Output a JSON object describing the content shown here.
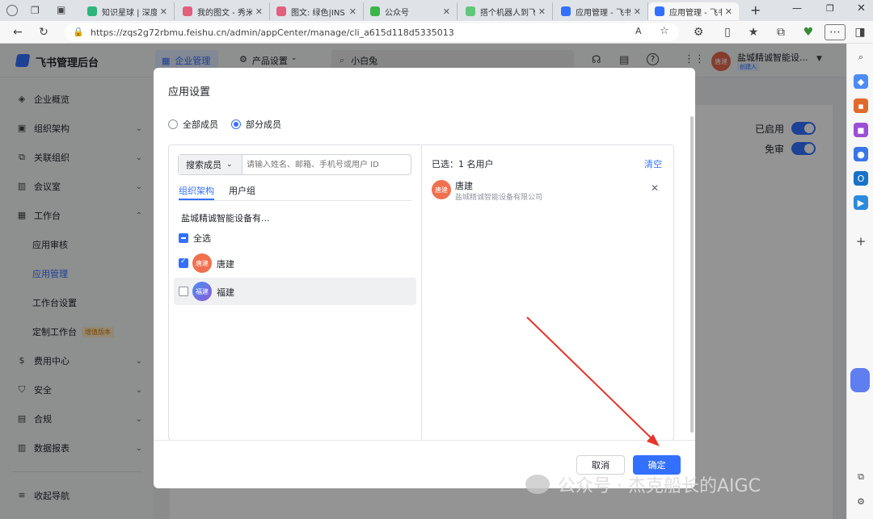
{
  "browser": {
    "tabs": [
      {
        "label": "知识星球 | 深度连",
        "color": "#2fb57b"
      },
      {
        "label": "我的图文 - 秀米XI",
        "color": "#e0607e"
      },
      {
        "label": "图文: 绿色|INS|简",
        "color": "#e0607e"
      },
      {
        "label": "公众号",
        "color": "#3bb54a"
      },
      {
        "label": "搭个机器人到飞书",
        "color": "#5ec77a"
      },
      {
        "label": "应用管理 - 飞书管",
        "color": "#3370ff"
      },
      {
        "label": "应用管理 - 飞书管",
        "color": "#3370ff"
      }
    ],
    "url": "https://zqs2g72rbmu.feishu.cn/admin/appCenter/manage/cli_a615d118d5335013"
  },
  "app": {
    "logo": "飞书管理后台",
    "nav_tabs": [
      "企业管理",
      "产品设置"
    ],
    "search_value": "小白兔",
    "org_name": "盐城精诚智能设...",
    "org_badge": "创建人",
    "avatar_text": "唐建"
  },
  "sidebar": {
    "items": [
      {
        "label": "企业概览",
        "icon": "layers-icon"
      },
      {
        "label": "组织架构",
        "icon": "org-icon"
      },
      {
        "label": "关联组织",
        "icon": "link-icon"
      },
      {
        "label": "会议室",
        "icon": "room-icon"
      },
      {
        "label": "工作台",
        "icon": "grid-icon"
      },
      {
        "label": "应用审核",
        "icon": ""
      },
      {
        "label": "应用管理",
        "icon": ""
      },
      {
        "label": "工作台设置",
        "icon": ""
      },
      {
        "label": "定制工作台",
        "icon": ""
      },
      {
        "label": "费用中心",
        "icon": "dollar-icon"
      },
      {
        "label": "安全",
        "icon": "shield-icon"
      },
      {
        "label": "合规",
        "icon": "compliance-icon"
      },
      {
        "label": "数据报表",
        "icon": "chart-icon"
      }
    ],
    "enhanced_badge": "增值版本",
    "collapse": "收起导航"
  },
  "background": {
    "enabled_label": "已启用",
    "exempt_label": "免审"
  },
  "modal": {
    "title": "应用设置",
    "radio_all": "全部成员",
    "radio_partial": "部分成员",
    "search_type": "搜索成员",
    "search_placeholder": "请输入姓名、邮箱、手机号或用户 ID",
    "tab_org": "组织架构",
    "tab_group": "用户组",
    "org_name": "盐城精诚智能设备有...",
    "select_all": "全选",
    "members": [
      {
        "name": "唐建",
        "avatar": "唐建",
        "checked": true,
        "color": "#f0704f"
      },
      {
        "name": "福建",
        "avatar": "福建",
        "checked": false,
        "color": "#5b72e8"
      }
    ],
    "selected_summary": "已选：1 名用户",
    "clear": "清空",
    "selected_user": {
      "name": "唐建",
      "avatar": "唐建",
      "company": "盐城精诚智能设备有限公司"
    },
    "cancel": "取消",
    "confirm": "确定"
  },
  "watermark": "公众号 · 杰克船长的AIGC"
}
